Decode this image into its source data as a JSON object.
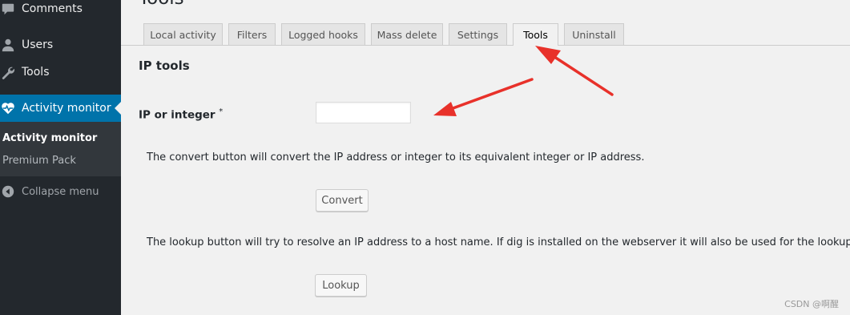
{
  "sidebar": {
    "items": [
      {
        "label": "Comments",
        "icon": "comment-icon"
      },
      {
        "label": "Users",
        "icon": "user-icon"
      },
      {
        "label": "Tools",
        "icon": "wrench-icon"
      },
      {
        "label": "Activity monitor",
        "icon": "heart-icon",
        "active": true
      }
    ],
    "submenu": [
      {
        "label": "Activity monitor",
        "current": true
      },
      {
        "label": "Premium Pack",
        "current": false
      }
    ],
    "collapse_label": "Collapse menu"
  },
  "page": {
    "title": "Tools"
  },
  "tabs": [
    {
      "label": "Local activity"
    },
    {
      "label": "Filters"
    },
    {
      "label": "Logged hooks"
    },
    {
      "label": "Mass delete"
    },
    {
      "label": "Settings"
    },
    {
      "label": "Tools",
      "active": true
    },
    {
      "label": "Uninstall"
    }
  ],
  "ip_tools": {
    "section_title": "IP tools",
    "field_label": "IP or integer",
    "required_marker": "*",
    "input_value": "",
    "convert_desc": "The convert button will convert the IP address or integer to its equivalent integer or IP address.",
    "convert_label": "Convert",
    "lookup_desc": "The lookup button will try to resolve an IP address to a host name. If dig is installed on the webserver it will also be used for the lookup.",
    "lookup_label": "Lookup"
  },
  "watermark": "CSDN @啊醒",
  "colors": {
    "sidebar_bg": "#23282d",
    "active_bg": "#0073aa",
    "annotation_arrow": "#e8312a"
  }
}
